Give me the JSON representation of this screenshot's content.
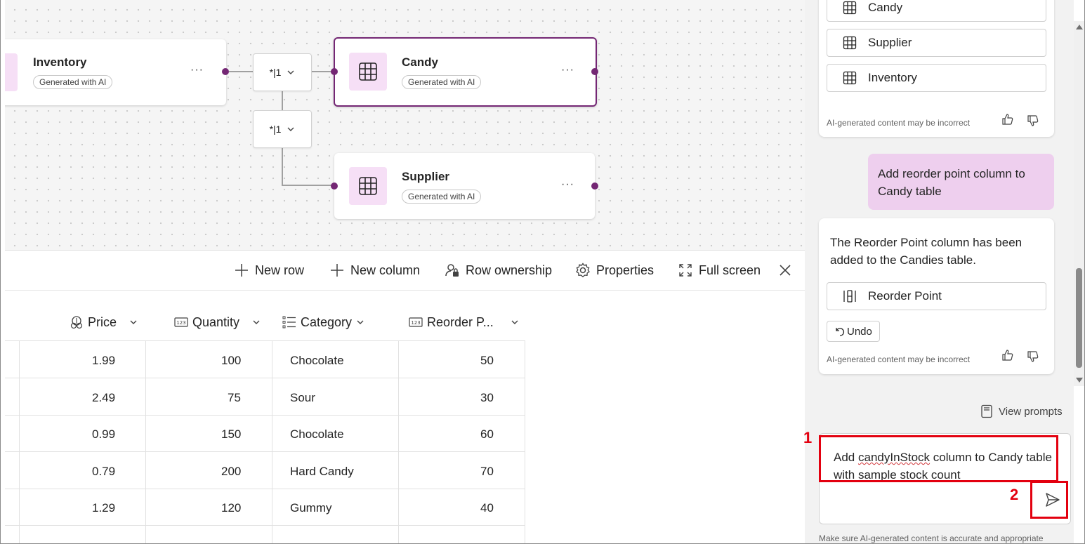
{
  "canvas": {
    "nodes": {
      "inventory": {
        "title": "Inventory",
        "badge": "Generated with AI",
        "more": "···"
      },
      "candy": {
        "title": "Candy",
        "badge": "Generated with AI",
        "more": "···"
      },
      "supplier": {
        "title": "Supplier",
        "badge": "Generated with AI",
        "more": "···"
      }
    },
    "relationships": [
      {
        "label": "*|1"
      },
      {
        "label": "*|1"
      }
    ]
  },
  "toolbar": {
    "new_row": "New row",
    "new_column": "New column",
    "row_ownership": "Row ownership",
    "properties": "Properties",
    "full_screen": "Full screen"
  },
  "table": {
    "columns": [
      "Price",
      "Quantity",
      "Category",
      "Reorder P..."
    ],
    "column_icons": [
      "currency-icon",
      "number-icon",
      "choice-list-icon",
      "number-icon"
    ],
    "rows": [
      [
        "1.99",
        "100",
        "Chocolate",
        "50"
      ],
      [
        "2.49",
        "75",
        "Sour",
        "30"
      ],
      [
        "0.99",
        "150",
        "Chocolate",
        "60"
      ],
      [
        "0.79",
        "200",
        "Hard Candy",
        "70"
      ],
      [
        "1.29",
        "120",
        "Gummy",
        "40"
      ]
    ]
  },
  "copilot": {
    "table_refs": [
      "Candy",
      "Supplier",
      "Inventory"
    ],
    "disclaimer": "AI-generated content may be incorrect",
    "user_message": "Add reorder point column to Candy table",
    "reply_text": "The Reorder Point column has been added to the Candies table.",
    "reply_ref": "Reorder Point",
    "undo": "Undo",
    "view_prompts": "View prompts",
    "input_value_pre": "Add ",
    "input_value_word": "candyInStock",
    "input_value_post": " column to Candy table with sample stock count",
    "footer": "Make sure AI-generated content is accurate and appropriate"
  },
  "annotations": {
    "label_1": "1",
    "label_2": "2"
  },
  "colors": {
    "brand": "#742774",
    "user_bubble": "#eecfee",
    "icon_bg": "#f6dff6",
    "annotation_red": "#e3000f"
  }
}
